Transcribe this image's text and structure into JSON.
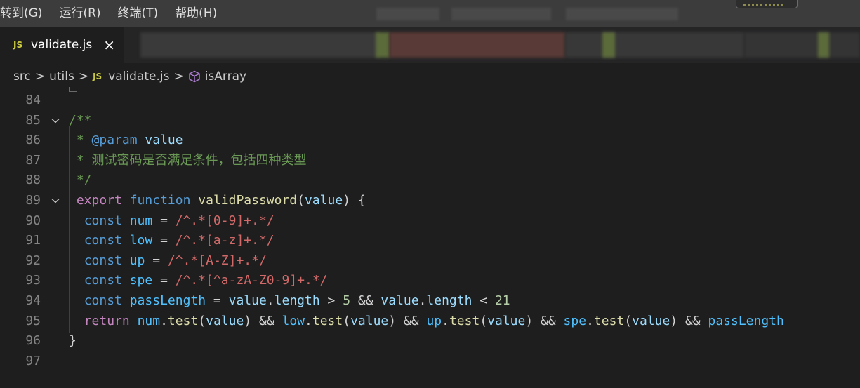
{
  "menu": [
    "转到(G)",
    "运行(R)",
    "终端(T)",
    "帮助(H)"
  ],
  "tab": {
    "badge": "JS",
    "label": "validate.js",
    "close": "×"
  },
  "breadcrumb": {
    "parts": [
      "src",
      "utils"
    ],
    "file_badge": "JS",
    "file": "validate.js",
    "symbol": "isArray",
    "separator": ">"
  },
  "colors": {
    "menubar": "#3c3c3c",
    "tabbar": "#252526",
    "editor_bg": "#1e1e1e",
    "js_badge": "#cbcb41",
    "comment": "#6a9955",
    "keyword": "#c586c0",
    "storage": "#569cd6",
    "function": "#dcdcaa",
    "variable": "#4fc1ff",
    "regex": "#d16969",
    "number": "#b5cea8",
    "line_number": "#858585"
  },
  "icons": {
    "close": "close-icon",
    "chevron": "chevron-right-icon",
    "symbol": "method-cube-icon",
    "fold": "chevron-down-icon"
  },
  "lines": [
    {
      "num": "84",
      "tokens": []
    },
    {
      "num": "85",
      "fold": true,
      "tokens": [
        {
          "t": "/**",
          "c": "comment"
        }
      ]
    },
    {
      "num": "86",
      "tokens": [
        {
          "t": " * ",
          "c": "comment"
        },
        {
          "t": "@param",
          "c": "doctag"
        },
        {
          "t": " ",
          "c": "comment"
        },
        {
          "t": "value",
          "c": "docname"
        }
      ]
    },
    {
      "num": "87",
      "tokens": [
        {
          "t": " * 测试密码是否满足条件，包括四种类型",
          "c": "comment"
        }
      ]
    },
    {
      "num": "88",
      "tokens": [
        {
          "t": " */",
          "c": "comment"
        }
      ]
    },
    {
      "num": "89",
      "fold": true,
      "tokens": [
        {
          "t": " ",
          "c": "op"
        },
        {
          "t": "export",
          "c": "kw"
        },
        {
          "t": " ",
          "c": "op"
        },
        {
          "t": "function",
          "c": "storage"
        },
        {
          "t": " ",
          "c": "op"
        },
        {
          "t": "validPassword",
          "c": "func"
        },
        {
          "t": "(",
          "c": "op"
        },
        {
          "t": "value",
          "c": "param"
        },
        {
          "t": ") {",
          "c": "op"
        }
      ]
    },
    {
      "num": "90",
      "tokens": [
        {
          "t": "  ",
          "c": "op"
        },
        {
          "t": "const",
          "c": "storage"
        },
        {
          "t": " ",
          "c": "op"
        },
        {
          "t": "num",
          "c": "var"
        },
        {
          "t": " = ",
          "c": "op"
        },
        {
          "t": "/^.*[0-9]+.*/",
          "c": "regex"
        }
      ]
    },
    {
      "num": "91",
      "tokens": [
        {
          "t": "  ",
          "c": "op"
        },
        {
          "t": "const",
          "c": "storage"
        },
        {
          "t": " ",
          "c": "op"
        },
        {
          "t": "low",
          "c": "var"
        },
        {
          "t": " = ",
          "c": "op"
        },
        {
          "t": "/^.*[a-z]+.*/",
          "c": "regex"
        }
      ]
    },
    {
      "num": "92",
      "tokens": [
        {
          "t": "  ",
          "c": "op"
        },
        {
          "t": "const",
          "c": "storage"
        },
        {
          "t": " ",
          "c": "op"
        },
        {
          "t": "up",
          "c": "var"
        },
        {
          "t": " = ",
          "c": "op"
        },
        {
          "t": "/^.*[A-Z]+.*/",
          "c": "regex"
        }
      ]
    },
    {
      "num": "93",
      "tokens": [
        {
          "t": "  ",
          "c": "op"
        },
        {
          "t": "const",
          "c": "storage"
        },
        {
          "t": " ",
          "c": "op"
        },
        {
          "t": "spe",
          "c": "var"
        },
        {
          "t": " = ",
          "c": "op"
        },
        {
          "t": "/^.*[^a-zA-Z0-9]+.*/",
          "c": "regex"
        }
      ]
    },
    {
      "num": "94",
      "tokens": [
        {
          "t": "  ",
          "c": "op"
        },
        {
          "t": "const",
          "c": "storage"
        },
        {
          "t": " ",
          "c": "op"
        },
        {
          "t": "passLength",
          "c": "var"
        },
        {
          "t": " = ",
          "c": "op"
        },
        {
          "t": "value",
          "c": "param"
        },
        {
          "t": ".",
          "c": "op"
        },
        {
          "t": "length",
          "c": "param"
        },
        {
          "t": " > ",
          "c": "op"
        },
        {
          "t": "5",
          "c": "num"
        },
        {
          "t": " && ",
          "c": "op"
        },
        {
          "t": "value",
          "c": "param"
        },
        {
          "t": ".",
          "c": "op"
        },
        {
          "t": "length",
          "c": "param"
        },
        {
          "t": " < ",
          "c": "op"
        },
        {
          "t": "21",
          "c": "num"
        }
      ]
    },
    {
      "num": "95",
      "tokens": [
        {
          "t": "  ",
          "c": "op"
        },
        {
          "t": "return",
          "c": "kw"
        },
        {
          "t": " ",
          "c": "op"
        },
        {
          "t": "num",
          "c": "var"
        },
        {
          "t": ".",
          "c": "op"
        },
        {
          "t": "test",
          "c": "func"
        },
        {
          "t": "(",
          "c": "op"
        },
        {
          "t": "value",
          "c": "param"
        },
        {
          "t": ") && ",
          "c": "op"
        },
        {
          "t": "low",
          "c": "var"
        },
        {
          "t": ".",
          "c": "op"
        },
        {
          "t": "test",
          "c": "func"
        },
        {
          "t": "(",
          "c": "op"
        },
        {
          "t": "value",
          "c": "param"
        },
        {
          "t": ") && ",
          "c": "op"
        },
        {
          "t": "up",
          "c": "var"
        },
        {
          "t": ".",
          "c": "op"
        },
        {
          "t": "test",
          "c": "func"
        },
        {
          "t": "(",
          "c": "op"
        },
        {
          "t": "value",
          "c": "param"
        },
        {
          "t": ") && ",
          "c": "op"
        },
        {
          "t": "spe",
          "c": "var"
        },
        {
          "t": ".",
          "c": "op"
        },
        {
          "t": "test",
          "c": "func"
        },
        {
          "t": "(",
          "c": "op"
        },
        {
          "t": "value",
          "c": "param"
        },
        {
          "t": ") && ",
          "c": "op"
        },
        {
          "t": "passLength",
          "c": "var"
        }
      ]
    },
    {
      "num": "96",
      "tokens": [
        {
          "t": "}",
          "c": "op"
        }
      ]
    },
    {
      "num": "97",
      "tokens": []
    }
  ]
}
